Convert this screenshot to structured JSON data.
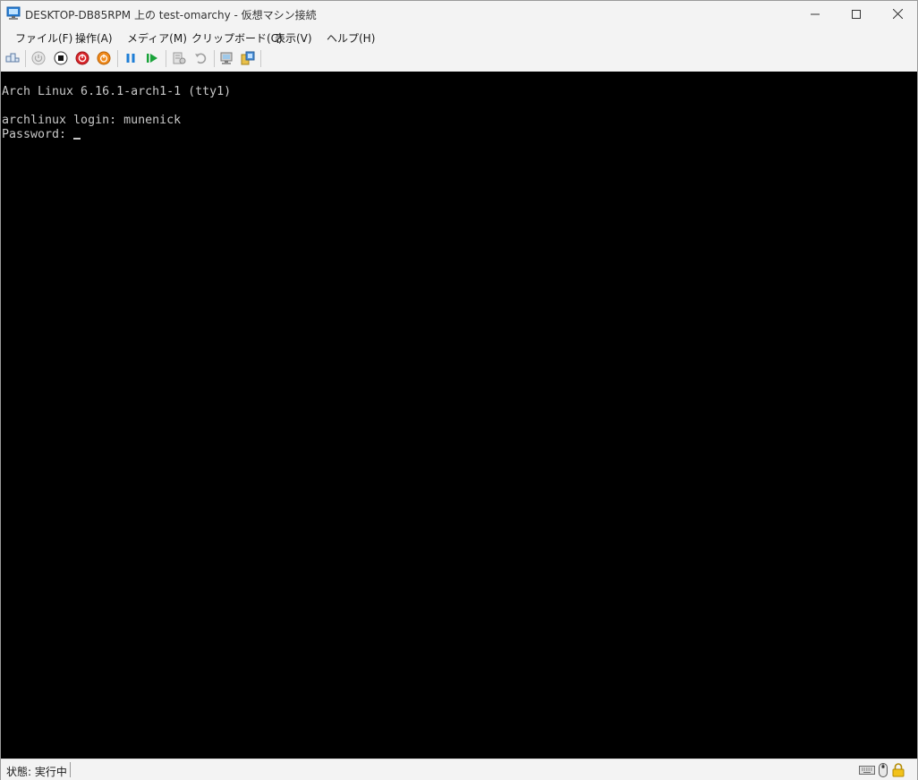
{
  "window": {
    "title": "DESKTOP-DB85RPM 上の test-omarchy  - 仮想マシン接続",
    "controls": [
      "minimize-icon",
      "maximize-icon",
      "close-icon"
    ]
  },
  "menu": {
    "items": [
      "ファイル(F)",
      "操作(A)",
      "メディア(M)",
      "クリップボード(C)",
      "表示(V)",
      "ヘルプ(H)"
    ]
  },
  "toolbar": {
    "buttons": [
      "ctrl-alt-del-icon",
      "start-icon",
      "turn-off-icon",
      "shut-down-icon",
      "save-icon",
      "pause-icon",
      "reset-icon",
      "checkpoint-icon",
      "revert-icon",
      "enhanced-session-icon",
      "share-icon"
    ]
  },
  "console": {
    "lines": [
      "Arch Linux 6.16.1-arch1-1 (tty1)",
      "",
      "archlinux login: munenick",
      "Password: "
    ]
  },
  "status": {
    "text": "状態: 実行中",
    "icons": [
      "keyboard-icon",
      "mouse-icon",
      "lock-icon"
    ]
  }
}
